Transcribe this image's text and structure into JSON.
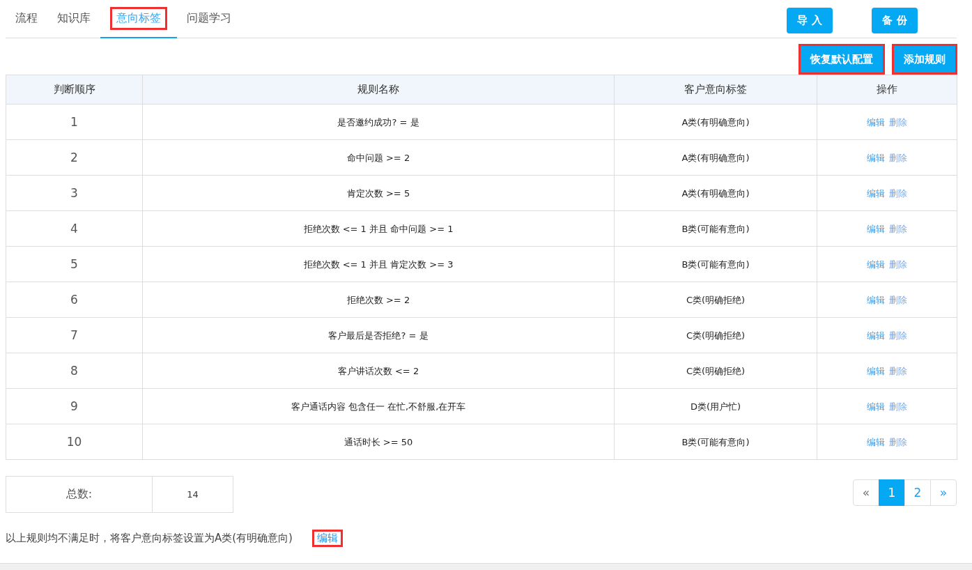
{
  "tabs": [
    {
      "label": "流程",
      "selected": false,
      "highlighted": false
    },
    {
      "label": "知识库",
      "selected": false,
      "highlighted": false
    },
    {
      "label": "意向标签",
      "selected": true,
      "highlighted": true
    },
    {
      "label": "问题学习",
      "selected": false,
      "highlighted": false
    }
  ],
  "top_buttons": [
    "导 入",
    "备 份"
  ],
  "action_buttons": [
    {
      "label": "恢复默认配置",
      "highlighted": true
    },
    {
      "label": "添加规则",
      "highlighted": true
    }
  ],
  "table": {
    "columns": [
      "判断顺序",
      "规则名称",
      "客户意向标签",
      "操作"
    ],
    "rows": [
      {
        "order": "1",
        "rule": "是否邀约成功? = 是",
        "tag": "A类(有明确意向)",
        "actions": [
          "编辑",
          "删除"
        ]
      },
      {
        "order": "2",
        "rule": "命中问题 >= 2",
        "tag": "A类(有明确意向)",
        "actions": [
          "编辑",
          "删除"
        ]
      },
      {
        "order": "3",
        "rule": "肯定次数 >= 5",
        "tag": "A类(有明确意向)",
        "actions": [
          "编辑",
          "删除"
        ]
      },
      {
        "order": "4",
        "rule": "拒绝次数 <= 1 并且 命中问题 >= 1",
        "tag": "B类(可能有意向)",
        "actions": [
          "编辑",
          "删除"
        ]
      },
      {
        "order": "5",
        "rule": "拒绝次数 <= 1 并且 肯定次数 >= 3",
        "tag": "B类(可能有意向)",
        "actions": [
          "编辑",
          "删除"
        ]
      },
      {
        "order": "6",
        "rule": "拒绝次数 >= 2",
        "tag": "C类(明确拒绝)",
        "actions": [
          "编辑",
          "删除"
        ]
      },
      {
        "order": "7",
        "rule": "客户最后是否拒绝? = 是",
        "tag": "C类(明确拒绝)",
        "actions": [
          "编辑",
          "删除"
        ]
      },
      {
        "order": "8",
        "rule": "客户讲话次数 <= 2",
        "tag": "C类(明确拒绝)",
        "actions": [
          "编辑",
          "删除"
        ]
      },
      {
        "order": "9",
        "rule": "客户通话内容 包含任一 在忙,不舒服,在开车",
        "tag": "D类(用户忙)",
        "actions": [
          "编辑",
          "删除"
        ]
      },
      {
        "order": "10",
        "rule": "通话时长 >= 50",
        "tag": "B类(可能有意向)",
        "actions": [
          "编辑",
          "删除"
        ]
      }
    ]
  },
  "total": {
    "label": "总数:",
    "value": "14"
  },
  "pagination": {
    "prev": "«",
    "pages": [
      {
        "label": "1",
        "selected": true
      },
      {
        "label": "2",
        "selected": false
      }
    ],
    "next": "»"
  },
  "footer": {
    "text": "以上规则均不满足时，将客户意向标签设置为A类(有明确意向)",
    "link": "编辑",
    "link_highlighted": true
  }
}
